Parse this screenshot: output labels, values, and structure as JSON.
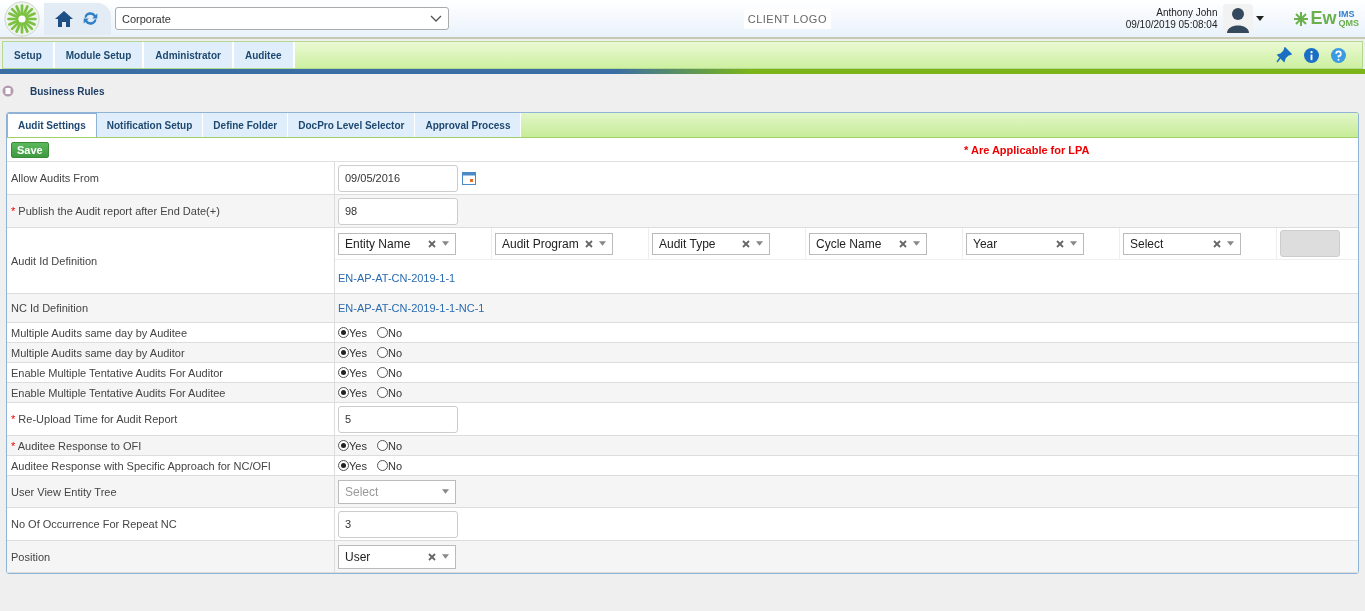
{
  "header": {
    "org_select": "Corporate",
    "client_logo": "CLIENT LOGO",
    "user_name": "Anthony John",
    "datetime": "09/10/2019 05:08:04",
    "brand": {
      "main": "Ew",
      "sup": "IMS",
      "sub": "QMS"
    }
  },
  "menu": [
    {
      "label": "Setup",
      "selected": false
    },
    {
      "label": "Module Setup",
      "selected": false
    },
    {
      "label": "Administrator",
      "selected": false
    },
    {
      "label": "Auditee",
      "selected": false
    }
  ],
  "breadcrumb": "Business Rules",
  "tabs": [
    {
      "label": "Audit Settings",
      "selected": true
    },
    {
      "label": "Notification Setup",
      "selected": false
    },
    {
      "label": "Define Folder",
      "selected": false
    },
    {
      "label": "DocPro Level Selector",
      "selected": false
    },
    {
      "label": "Approval Process",
      "selected": false
    }
  ],
  "save_button": "Save",
  "lpa_note": {
    "mark": "*",
    "text": "Are Applicable for LPA"
  },
  "rows": [
    {
      "kind": "date",
      "label": "Allow Audits From",
      "required": false,
      "value": "09/05/2016"
    },
    {
      "kind": "text",
      "label": "Publish the Audit report after End Date(+)",
      "required": true,
      "value": "98"
    },
    {
      "kind": "audit_id",
      "label": "Audit Id Definition",
      "required": false,
      "parts": [
        {
          "value": "Entity Name"
        },
        {
          "value": "Audit Program"
        },
        {
          "value": "Audit Type"
        },
        {
          "value": "Cycle Name"
        },
        {
          "value": "Year"
        },
        {
          "value": "Select"
        }
      ],
      "value": "EN-AP-AT-CN-2019-1-1"
    },
    {
      "kind": "nc_id",
      "label": "NC Id Definition",
      "required": false,
      "value": "EN-AP-AT-CN-2019-1-1-NC-1"
    },
    {
      "kind": "radio",
      "label": "Multiple Audits same day by Auditee",
      "required": false,
      "options": [
        {
          "label": "Yes",
          "selected": true
        },
        {
          "label": "No",
          "selected": false
        }
      ]
    },
    {
      "kind": "radio",
      "label": "Multiple Audits same day by Auditor",
      "required": false,
      "options": [
        {
          "label": "Yes",
          "selected": true
        },
        {
          "label": "No",
          "selected": false
        }
      ]
    },
    {
      "kind": "radio",
      "label": "Enable Multiple Tentative Audits For Auditor",
      "required": false,
      "options": [
        {
          "label": "Yes",
          "selected": true
        },
        {
          "label": "No",
          "selected": false
        }
      ]
    },
    {
      "kind": "radio",
      "label": "Enable Multiple Tentative Audits For Auditee",
      "required": false,
      "options": [
        {
          "label": "Yes",
          "selected": true
        },
        {
          "label": "No",
          "selected": false
        }
      ]
    },
    {
      "kind": "text",
      "label": "Re-Upload Time for Audit Report",
      "required": true,
      "value": "5"
    },
    {
      "kind": "radio",
      "label": "Auditee Response to OFI",
      "required": true,
      "options": [
        {
          "label": "Yes",
          "selected": true
        },
        {
          "label": "No",
          "selected": false
        }
      ]
    },
    {
      "kind": "radio",
      "label": "Auditee Response with Specific Approach for NC/OFI",
      "required": false,
      "options": [
        {
          "label": "Yes",
          "selected": true
        },
        {
          "label": "No",
          "selected": false
        }
      ]
    },
    {
      "kind": "select",
      "label": "User View Entity Tree",
      "required": false,
      "placeholder": "Select"
    },
    {
      "kind": "text",
      "label": "No Of Occurrence For Repeat NC",
      "required": false,
      "value": "3"
    },
    {
      "kind": "select",
      "label": "Position",
      "required": false,
      "value": "User"
    }
  ]
}
